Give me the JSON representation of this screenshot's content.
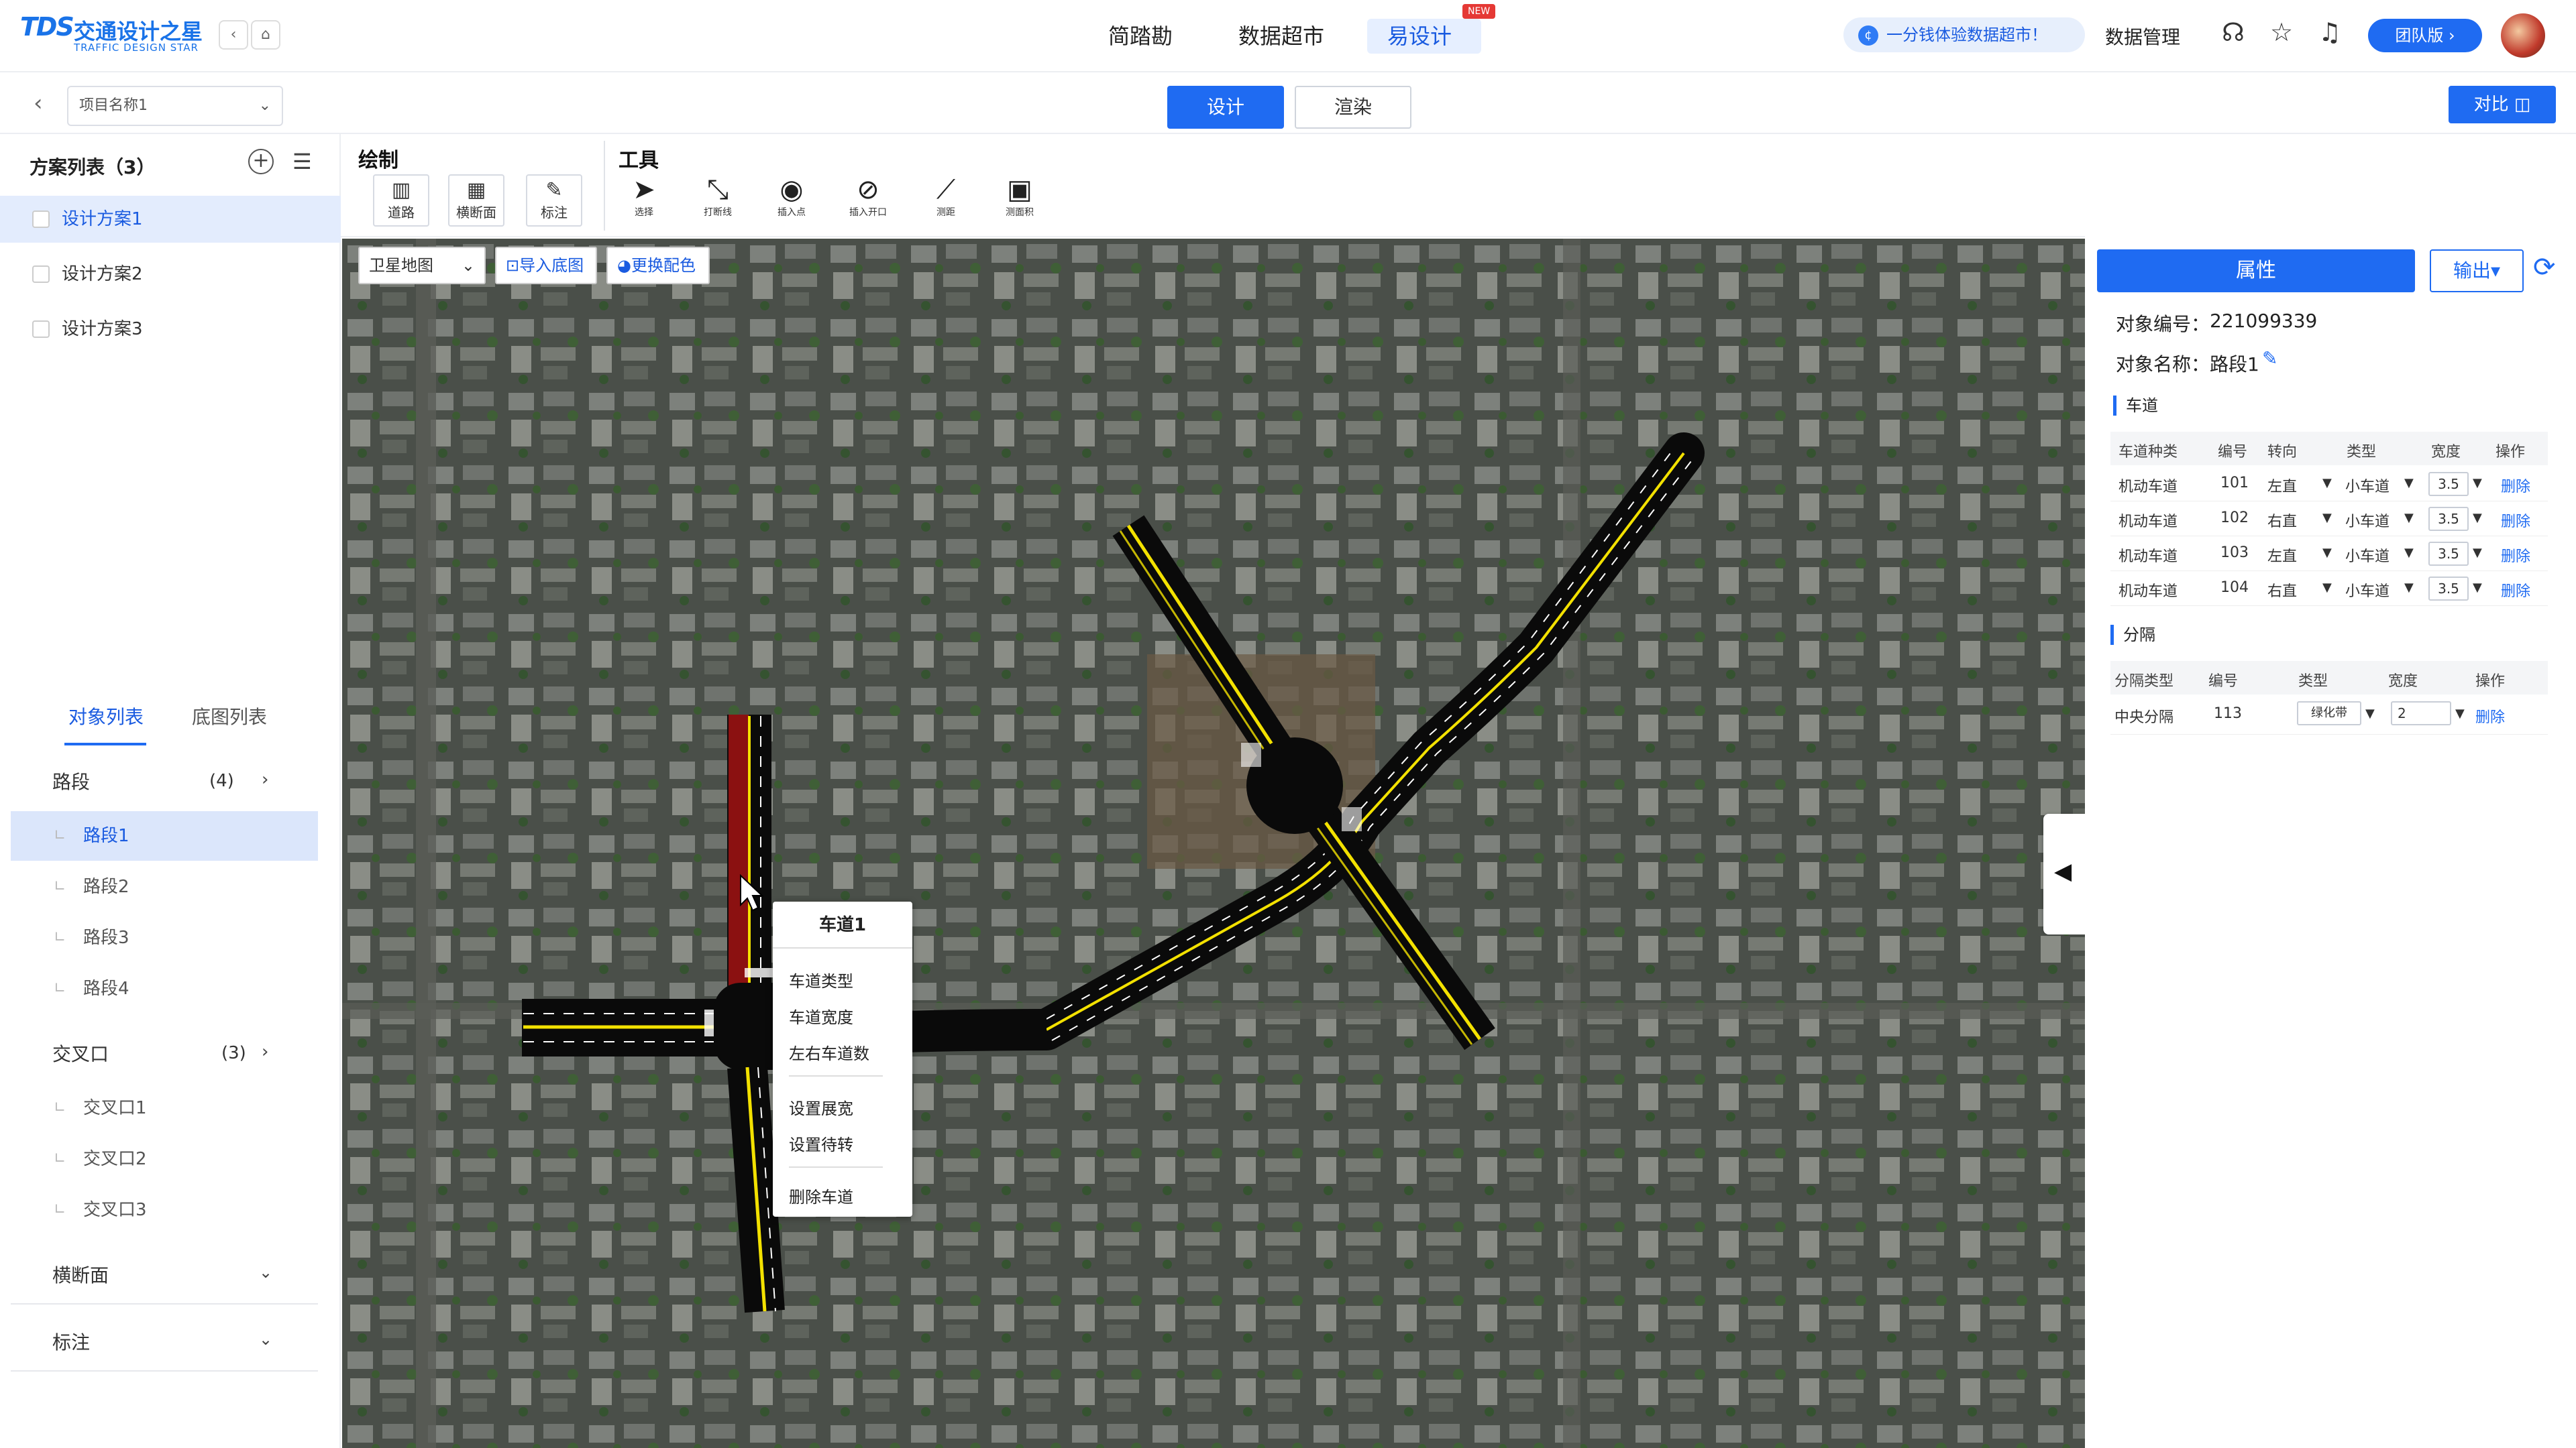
{
  "brand": {
    "mark": "TDS",
    "name_cn": "交通设计之星",
    "name_en": "TRAFFIC DESIGN STAR"
  },
  "topnav": {
    "items": [
      {
        "label": "简踏勘"
      },
      {
        "label": "数据超市"
      },
      {
        "label": "易设计"
      }
    ],
    "active_index": 2,
    "new_badge": "NEW"
  },
  "header_right": {
    "promo": "一分钱体验数据超市！",
    "data_manage": "数据管理",
    "team_button": "团队版",
    "icons": [
      "headset-icon",
      "star-icon",
      "bell-icon"
    ]
  },
  "secondbar": {
    "project_select": "项目名称1",
    "tabs": [
      {
        "label": "设计"
      },
      {
        "label": "渲染"
      }
    ],
    "active_tab": 0,
    "compare": "对比"
  },
  "scheme_list": {
    "title": "方案列表（3）",
    "items": [
      {
        "label": "设计方案1"
      },
      {
        "label": "设计方案2"
      },
      {
        "label": "设计方案3"
      }
    ],
    "active_index": 0
  },
  "object_tabs": [
    {
      "label": "对象列表"
    },
    {
      "label": "底图列表"
    }
  ],
  "object_tree": {
    "segments": {
      "label": "路段",
      "count": "(4)",
      "items": [
        "路段1",
        "路段2",
        "路段3",
        "路段4"
      ],
      "active_index": 0
    },
    "intersections": {
      "label": "交叉口",
      "count": "(3)",
      "items": [
        "交叉口1",
        "交叉口2",
        "交叉口3"
      ]
    },
    "cross_section": {
      "label": "横断面"
    },
    "annotation": {
      "label": "标注"
    }
  },
  "toolbar": {
    "draw_title": "绘制",
    "draw_tools": [
      {
        "label": "道路"
      },
      {
        "label": "横断面"
      },
      {
        "label": "标注"
      }
    ],
    "tool_title": "工具",
    "tools": [
      {
        "label": "选择"
      },
      {
        "label": "打断线"
      },
      {
        "label": "插入点"
      },
      {
        "label": "插入开口"
      },
      {
        "label": "测距"
      },
      {
        "label": "测面积"
      }
    ]
  },
  "map": {
    "basemap_select": "卫星地图",
    "import_basemap": "导入底图",
    "change_color": "更换配色"
  },
  "context_menu": {
    "title": "车道1",
    "items": [
      "车道类型",
      "车道宽度",
      "左右车道数",
      "设置展宽",
      "设置待转",
      "删除车道"
    ]
  },
  "properties": {
    "tab_label": "属性",
    "export_label": "输出",
    "object_id_label": "对象编号：",
    "object_id": "221099339",
    "object_name_label": "对象名称：",
    "object_name": "路段1",
    "lanes": {
      "title": "车道",
      "headers": [
        "车道种类",
        "编号",
        "转向",
        "类型",
        "宽度",
        "操作"
      ],
      "rows": [
        {
          "kind": "机动车道",
          "id": "101",
          "turn": "左直",
          "type": "小车道",
          "width": "3.5",
          "op": "删除"
        },
        {
          "kind": "机动车道",
          "id": "102",
          "turn": "右直",
          "type": "小车道",
          "width": "3.5",
          "op": "删除"
        },
        {
          "kind": "机动车道",
          "id": "103",
          "turn": "左直",
          "type": "小车道",
          "width": "3.5",
          "op": "删除"
        },
        {
          "kind": "机动车道",
          "id": "104",
          "turn": "右直",
          "type": "小车道",
          "width": "3.5",
          "op": "删除"
        }
      ]
    },
    "separators": {
      "title": "分隔",
      "headers": [
        "分隔类型",
        "编号",
        "类型",
        "宽度",
        "操作"
      ],
      "rows": [
        {
          "kind": "中央分隔",
          "id": "113",
          "type": "绿化带",
          "width": "2",
          "op": "删除"
        }
      ]
    }
  }
}
